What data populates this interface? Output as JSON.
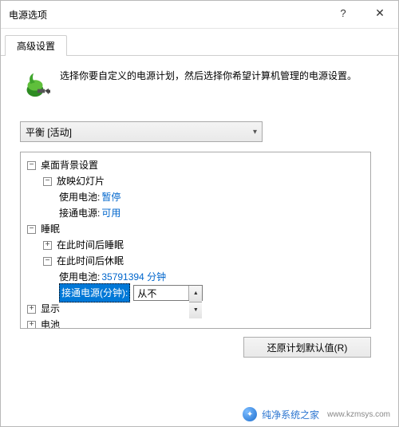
{
  "window": {
    "title": "电源选项",
    "help_glyph": "?",
    "close_glyph": "✕"
  },
  "tabs": {
    "advanced": "高级设置"
  },
  "intro": {
    "text": "选择你要自定义的电源计划，然后选择你希望计算机管理的电源设置。"
  },
  "plan_dropdown": {
    "selected": "平衡 [活动]"
  },
  "tree": {
    "desktop_bg": {
      "label": "桌面背景设置",
      "expanded": true
    },
    "slideshow": {
      "label": "放映幻灯片",
      "expanded": true
    },
    "slide_on_battery": {
      "label": "使用电池:",
      "value": "暂停"
    },
    "slide_plugged_in": {
      "label": "接通电源:",
      "value": "可用"
    },
    "sleep": {
      "label": "睡眠",
      "expanded": true
    },
    "sleep_after": {
      "label": "在此时间后睡眠",
      "expanded": false
    },
    "hibernate_after": {
      "label": "在此时间后休眠",
      "expanded": true
    },
    "hib_on_battery": {
      "label": "使用电池:",
      "value": "35791394 分钟"
    },
    "hib_plugged_in": {
      "label": "接通电源(分钟):",
      "value": "从不"
    },
    "display": {
      "label": "显示",
      "expanded": false
    },
    "battery": {
      "label": "电池",
      "expanded": false
    }
  },
  "buttons": {
    "restore_defaults": "还原计划默认值(R)"
  },
  "watermark": {
    "brand": "纯净系统之家",
    "url": "www.kzmsys.com"
  }
}
